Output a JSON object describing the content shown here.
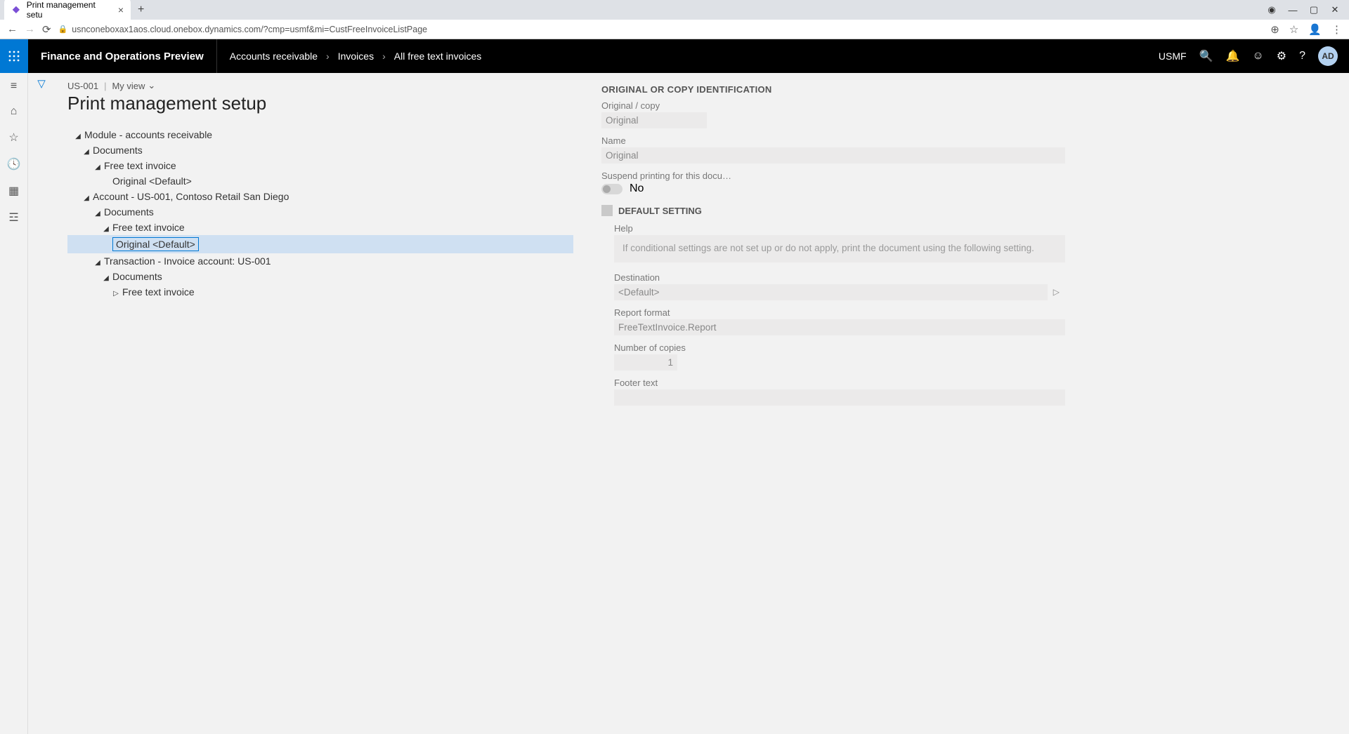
{
  "browser": {
    "tab_title": "Print management setu",
    "url": "usnconeboxax1aos.cloud.onebox.dynamics.com/?cmp=usmf&mi=CustFreeInvoiceListPage"
  },
  "header": {
    "product": "Finance and Operations Preview",
    "crumb1": "Accounts receivable",
    "crumb2": "Invoices",
    "crumb3": "All free text invoices",
    "company": "USMF",
    "avatar": "AD"
  },
  "page": {
    "context_id": "US-001",
    "view_label": "My view",
    "title": "Print management setup"
  },
  "tree": {
    "n1": "Module - accounts receivable",
    "n2": "Documents",
    "n3": "Free text invoice",
    "n4": "Original <Default>",
    "n5": "Account - US-001, Contoso Retail San Diego",
    "n6": "Documents",
    "n7": "Free text invoice",
    "n8": "Original <Default>",
    "n9": "Transaction - Invoice account: US-001",
    "n10": "Documents",
    "n11": "Free text invoice"
  },
  "form": {
    "section1_title": "ORIGINAL OR COPY IDENTIFICATION",
    "origcopy_label": "Original / copy",
    "origcopy_value": "Original",
    "name_label": "Name",
    "name_value": "Original",
    "suspend_label": "Suspend printing for this docu…",
    "suspend_value": "No",
    "default_setting_label": "DEFAULT SETTING",
    "help_label": "Help",
    "help_text": "If conditional settings are not set up or do not apply, print the document using the following setting.",
    "destination_label": "Destination",
    "destination_value": "<Default>",
    "report_format_label": "Report format",
    "report_format_value": "FreeTextInvoice.Report",
    "copies_label": "Number of copies",
    "copies_value": "1",
    "footer_label": "Footer text",
    "footer_value": ""
  }
}
